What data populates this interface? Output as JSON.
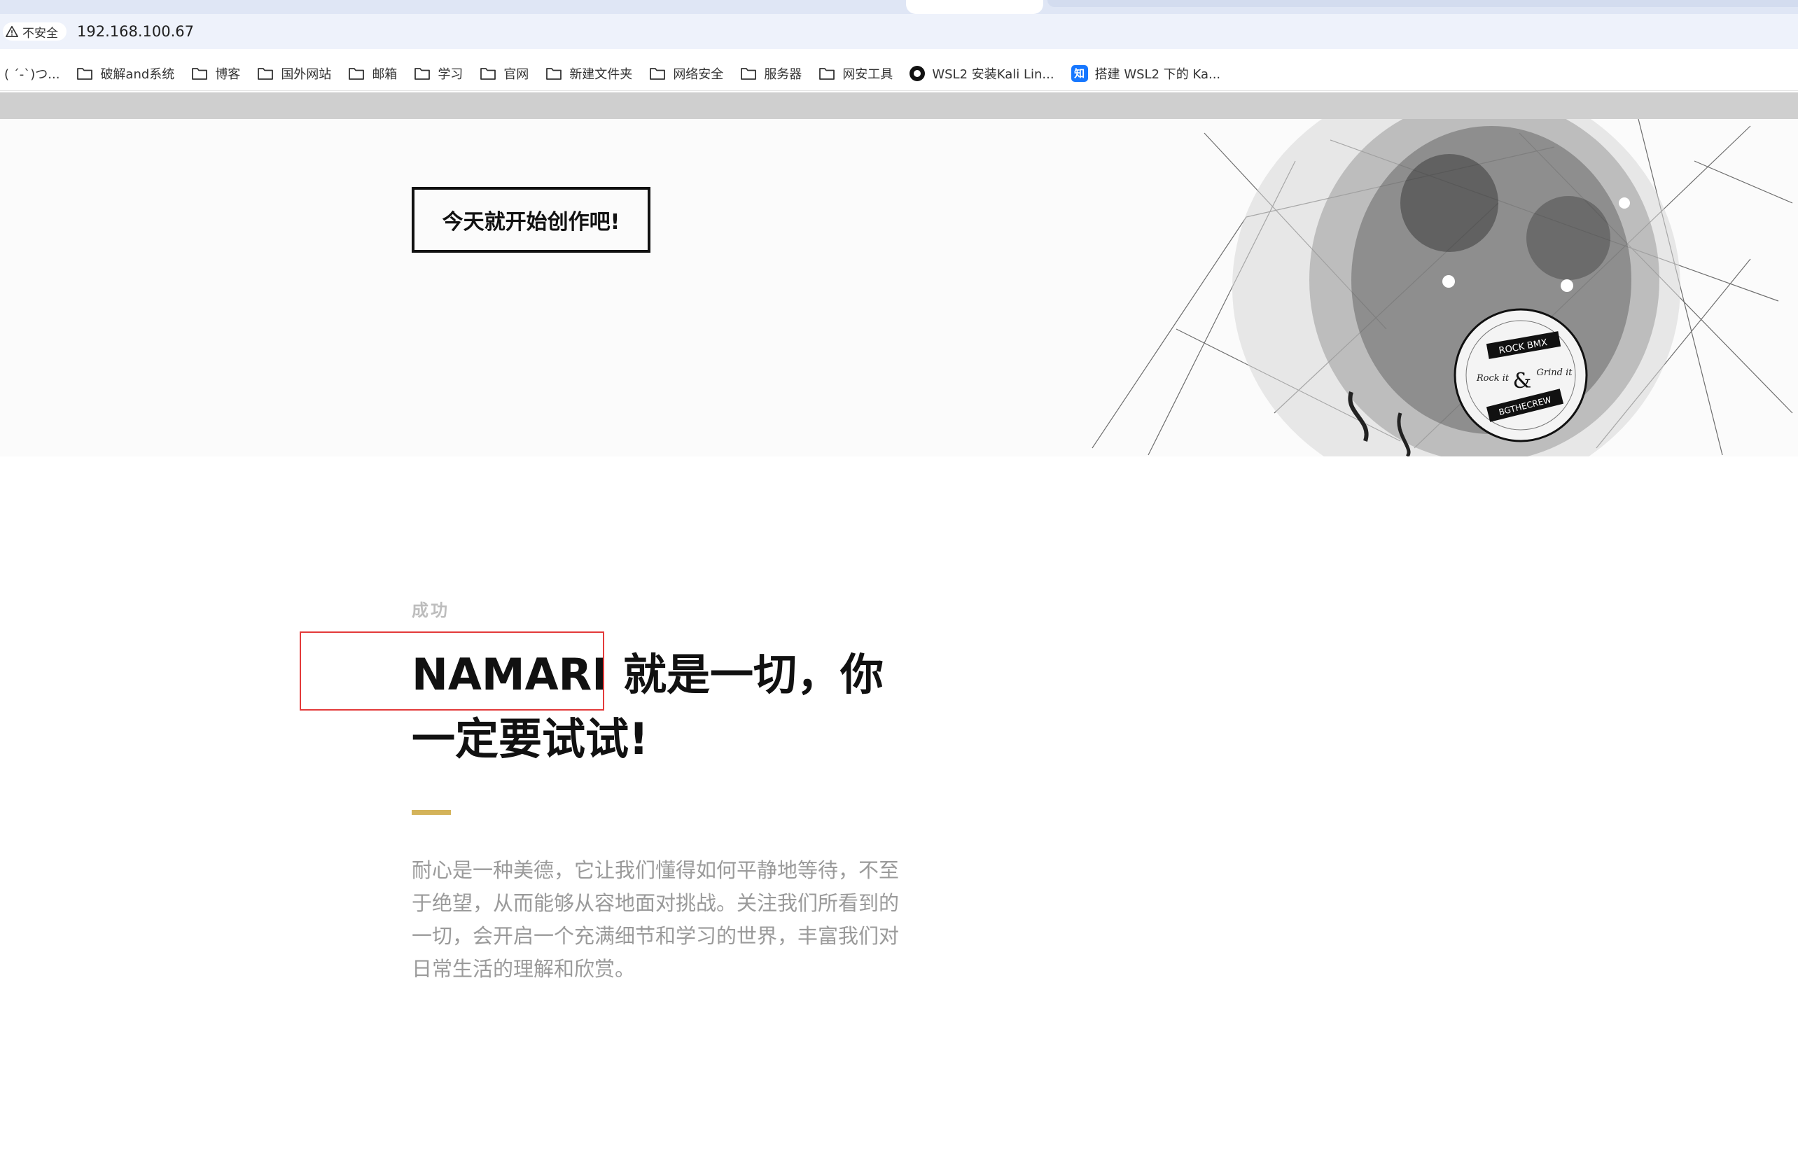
{
  "browser": {
    "security_label": "不安全",
    "url": "192.168.100.67",
    "bookmarks": [
      {
        "label": "( ´-`)つ...",
        "icon": "none"
      },
      {
        "label": "破解and系统",
        "icon": "folder-icon"
      },
      {
        "label": "博客",
        "icon": "folder-icon"
      },
      {
        "label": "国外网站",
        "icon": "folder-icon"
      },
      {
        "label": "邮箱",
        "icon": "folder-icon"
      },
      {
        "label": "学习",
        "icon": "folder-icon"
      },
      {
        "label": "官网",
        "icon": "folder-icon"
      },
      {
        "label": "新建文件夹",
        "icon": "folder-icon"
      },
      {
        "label": "网络安全",
        "icon": "folder-icon"
      },
      {
        "label": "服务器",
        "icon": "folder-icon"
      },
      {
        "label": "网安工具",
        "icon": "folder-icon"
      },
      {
        "label": "WSL2 安装Kali Lin...",
        "icon": "circle-favicon"
      },
      {
        "label": "搭建 WSL2 下的 Ka...",
        "icon": "zhihu-favicon"
      }
    ],
    "zhihu_glyph": "知"
  },
  "hero": {
    "cta_label": "今天就开始创作吧!",
    "sketch_text": {
      "top": "ROCK BMX",
      "middle_left": "Rock it",
      "middle_right": "Grind it",
      "bottom": "BGTHECREW"
    }
  },
  "section": {
    "eyebrow": "成功",
    "headline_line1": "NAMARI 就是一切，你",
    "headline_line2": "一定要试试!",
    "body": "耐心是一种美德，它让我们懂得如何平静地等待，不至于绝望，从而能够从容地面对挑战。关注我们所看到的一切，会开启一个充满细节和学习的世界，丰富我们对日常生活的理解和欣赏。"
  },
  "colors": {
    "accent_rule": "#d4b35a",
    "highlight_box": "#e33a3a",
    "muted_text": "#9a9a9a"
  }
}
